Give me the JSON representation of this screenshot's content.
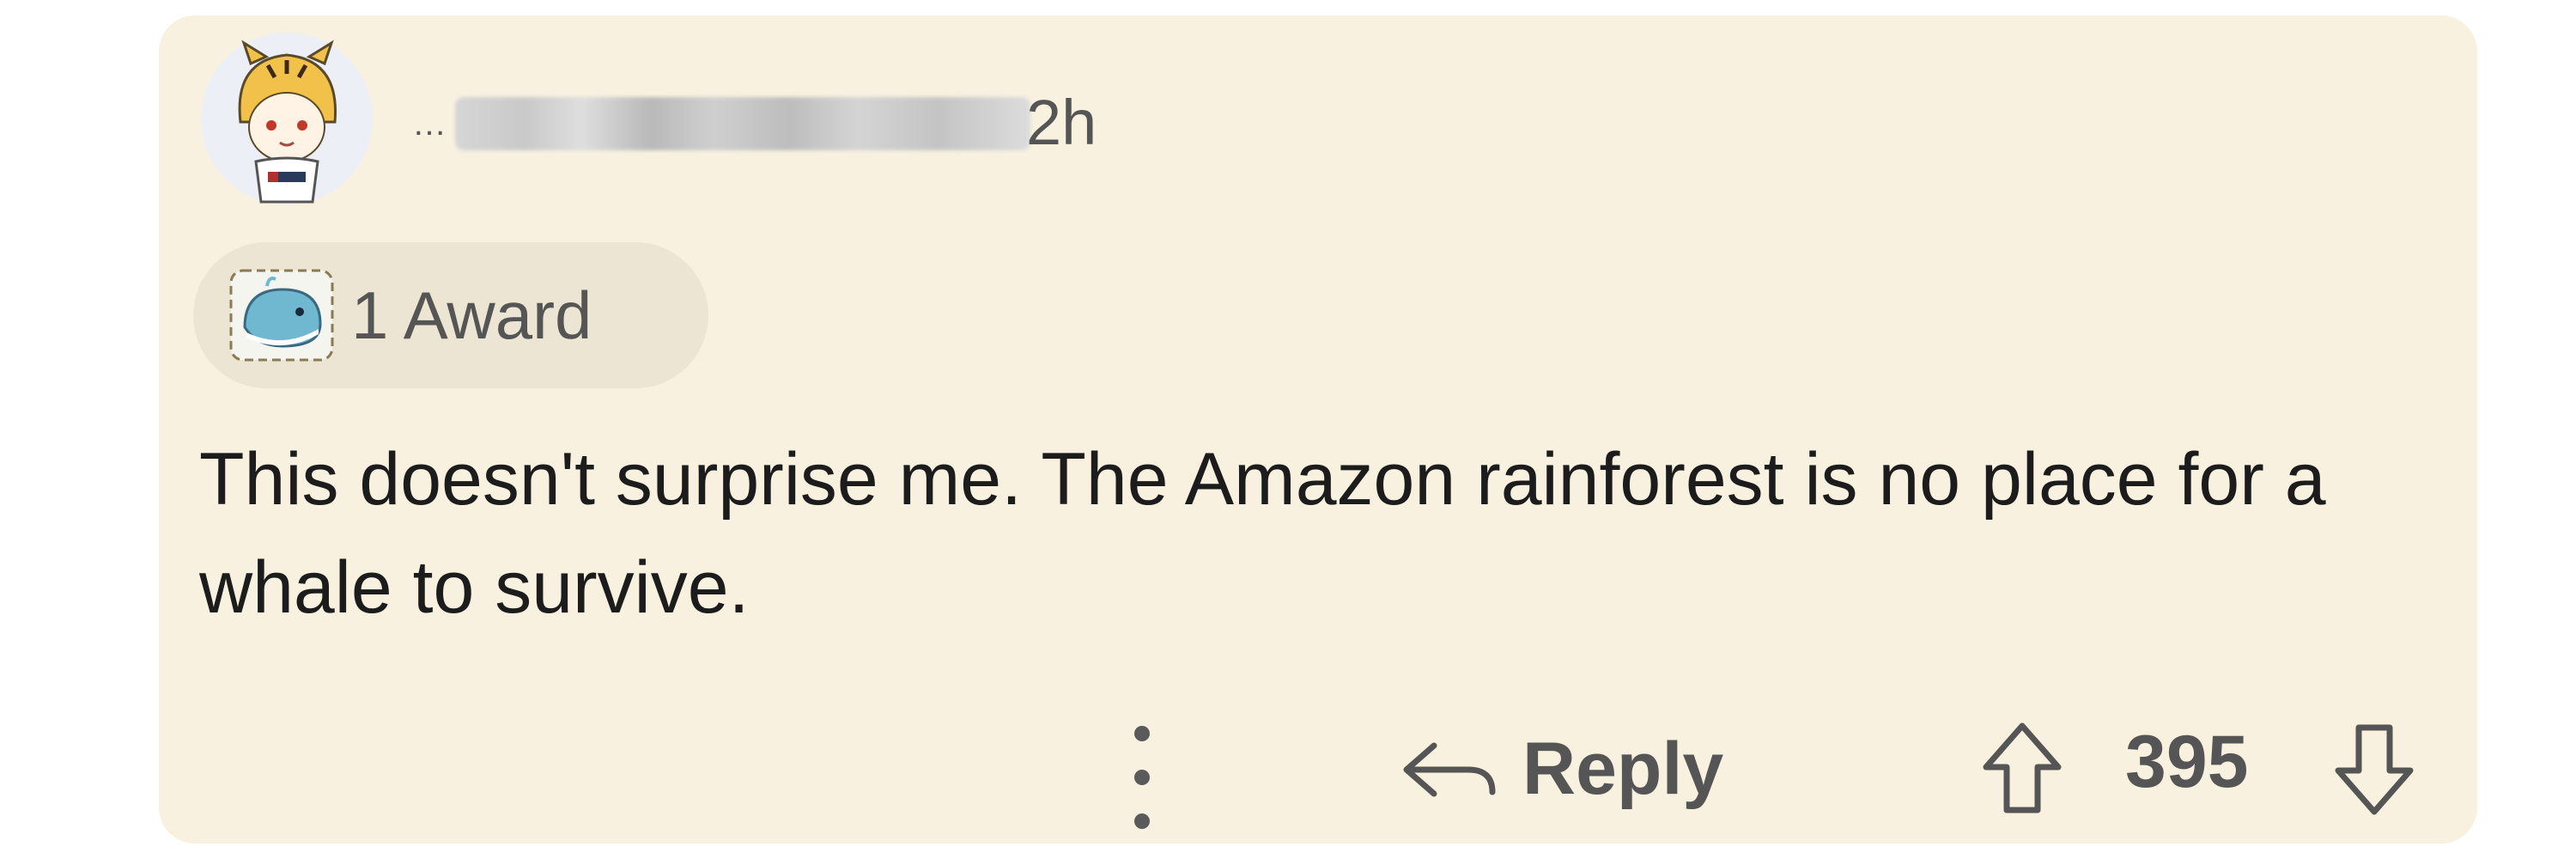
{
  "comment": {
    "author_redacted": "…",
    "timestamp": "2h",
    "award": {
      "icon": "whale-award-icon",
      "label": "1 Award"
    },
    "body": "This doesn't surprise me. The Amazon rainforest is no place for a whale to survive.",
    "actions": {
      "more_icon": "more-vertical-icon",
      "reply_icon": "reply-arrow-icon",
      "reply_label": "Reply",
      "upvote_icon": "upvote-arrow-icon",
      "score": "395",
      "downvote_icon": "downvote-arrow-icon"
    }
  },
  "colors": {
    "card_background": "#f8f1e0",
    "award_pill_background": "#ece5d3",
    "body_text": "#1c1c1c",
    "secondary_text": "#555555"
  }
}
